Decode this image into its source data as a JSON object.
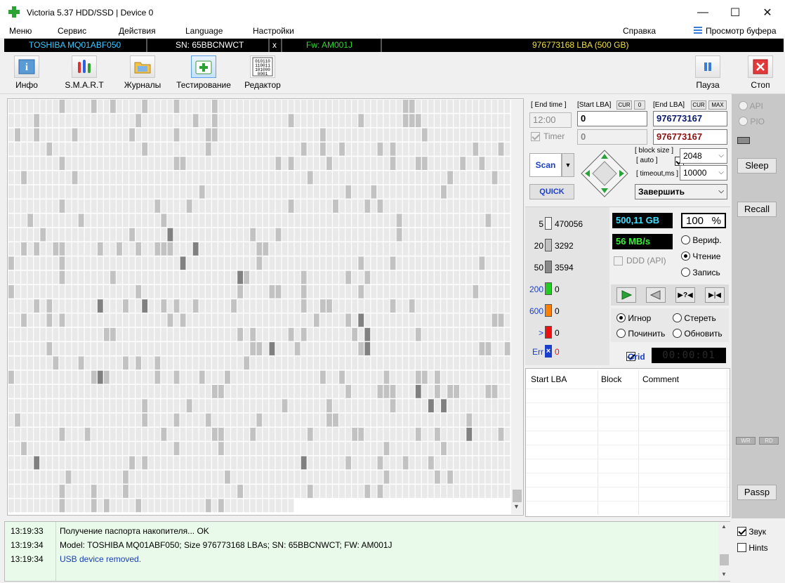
{
  "window": {
    "title": "Victoria 5.37 HDD/SSD | Device 0",
    "minimize": "—",
    "maximize": "☐",
    "close": "✕"
  },
  "menu": {
    "items": [
      "Меню",
      "Сервис",
      "Действия",
      "Language",
      "Настройки",
      "Справка"
    ],
    "buffer_view": "Просмотр буфера"
  },
  "drive": {
    "model": "TOSHIBA MQ01ABF050",
    "serial": "SN: 65BBCNWCT",
    "close_mark": "x",
    "firmware": "Fw: AM001J",
    "capacity": "976773168 LBA (500 GB)"
  },
  "toolbar": {
    "info": "Инфо",
    "smart": "S.M.A.R.T",
    "logs": "Журналы",
    "test": "Тестирование",
    "editor": "Редактор",
    "pause": "Пауза",
    "stop": "Стоп",
    "editor_icon_text": "010110 110011 101000 0001"
  },
  "scan": {
    "end_time_label": "[ End time ]",
    "end_time_value": "12:00",
    "timer_label": "Timer",
    "start_lba_label": "[Start LBA]",
    "cur_label": "CUR",
    "cur_value": "0",
    "start_lba": "0",
    "start_lba_2": "0",
    "end_lba_label": "[End LBA]",
    "max_label": "MAX",
    "end_lba": "976773167",
    "end_lba_2": "976773167",
    "scan_button": "Scan",
    "quick_button": "QUICK",
    "block_size_label": "[ block size ]",
    "auto_label": "[ auto ]",
    "timeout_label": "[ timeout,ms ]",
    "block_size": "2048",
    "timeout": "10000",
    "finish_action": "Завершить"
  },
  "legend": [
    {
      "label": "5",
      "value": "470056",
      "color": "#f4f4f4"
    },
    {
      "label": "20",
      "value": "3292",
      "color": "#c0c0c0"
    },
    {
      "label": "50",
      "value": "3594",
      "color": "#8a8a8a"
    },
    {
      "label": "200",
      "value": "0",
      "color": "#22cc22"
    },
    {
      "label": "600",
      "value": "0",
      "color": "#ff7f00"
    },
    {
      "label": ">",
      "value": "0",
      "color": "#ee1111"
    },
    {
      "label": "Err",
      "value": "0",
      "color": "#1a3fcc"
    }
  ],
  "status": {
    "size": "500,11 GB",
    "percent": "100",
    "percent_sign": "%",
    "speed": "56 MB/s",
    "ddd": "DDD (API)",
    "mode_verify": "Вериф.",
    "mode_read": "Чтение",
    "mode_write": "Запись",
    "action_ignore": "Игнор",
    "action_erase": "Стереть",
    "action_repair": "Починить",
    "action_refresh": "Обновить",
    "grid_label": "Grid",
    "timer_display": "00:00:01"
  },
  "lba_table": {
    "columns": [
      "Start LBA",
      "Block",
      "Comment"
    ]
  },
  "side": {
    "api": "API",
    "pio": "PIO",
    "sleep": "Sleep",
    "recall": "Recall",
    "wr": "WR",
    "rd": "RD",
    "passp": "Passp"
  },
  "log": [
    {
      "time": "13:19:33",
      "msg": "Получение паспорта накопителя... OK",
      "color": "#000000"
    },
    {
      "time": "13:19:34",
      "msg": "Model: TOSHIBA MQ01ABF050; Size 976773168 LBAs; SN: 65BBCNWCT; FW: AM001J",
      "color": "#000000"
    },
    {
      "time": "13:19:34",
      "msg": "USB device removed.",
      "color": "#1a3fb0"
    }
  ],
  "options": {
    "sound": "Звук",
    "hints": "Hints"
  },
  "colors": {
    "drive_model": "#3ec8ff",
    "drive_fw": "#34d434",
    "drive_capacity": "#f0e040",
    "lcd_cyan": "#40e0ff",
    "lcd_green": "#3cf03c",
    "accent_blue": "#1a3fcc"
  }
}
